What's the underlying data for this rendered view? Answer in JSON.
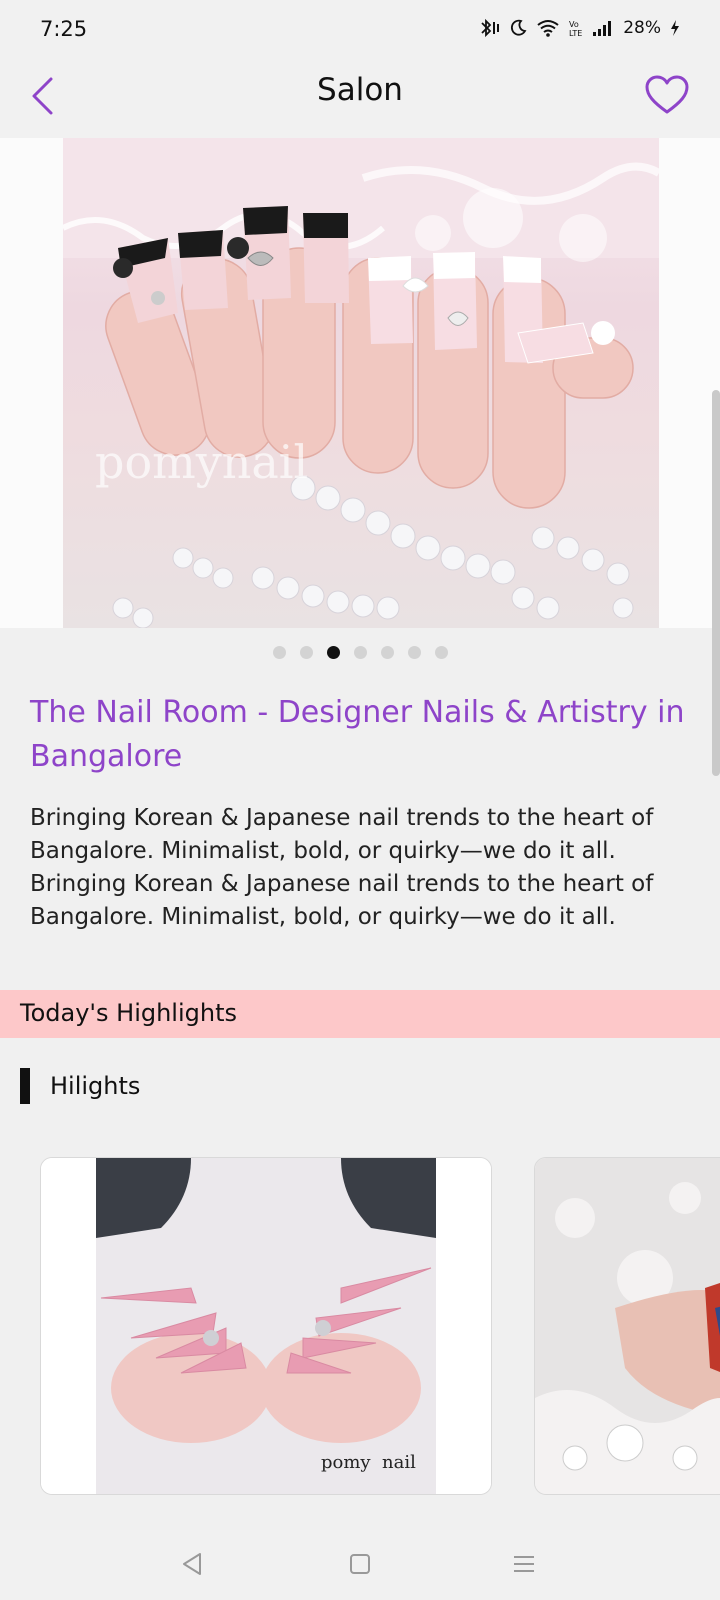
{
  "status_bar": {
    "time": "7:25",
    "battery": "28%",
    "icons": [
      "bluetooth-icon",
      "do-not-disturb-icon",
      "wifi-icon",
      "volte-icon",
      "signal-icon",
      "charging-icon"
    ]
  },
  "header": {
    "title": "Salon",
    "back_icon": "chevron-left-icon",
    "favorite_icon": "heart-outline-icon",
    "accent_color": "#8e44c9"
  },
  "gallery": {
    "watermark": "pomynail",
    "page_count": 7,
    "active_page": 3
  },
  "salon": {
    "name": "The Nail Room - Designer Nails & Artistry in Bangalore",
    "description": "Bringing Korean & Japanese nail trends to the heart of Bangalore. Minimalist, bold, or quirky—we do it all. Bringing Korean & Japanese nail trends to the heart of Bangalore. Minimalist, bold, or quirky—we do it all."
  },
  "highlights": {
    "banner": "Today's Highlights",
    "banner_color": "#fdc8c9",
    "section_label": "Hilights",
    "cards": [
      {
        "watermark": "pomy  nail"
      },
      {
        "watermark": ""
      }
    ]
  },
  "nav": {
    "icons": [
      "back-triangle-icon",
      "home-square-icon",
      "menu-lines-icon"
    ]
  }
}
